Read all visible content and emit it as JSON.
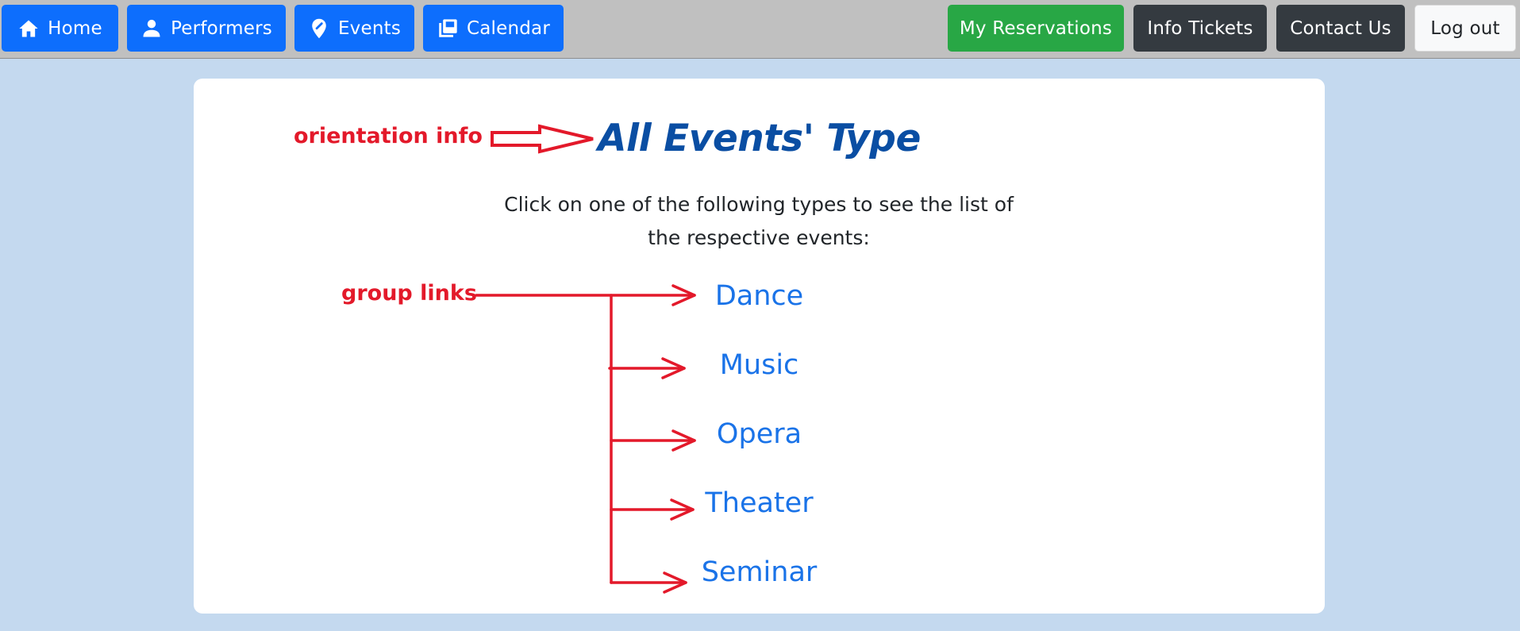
{
  "nav": {
    "left": [
      {
        "id": "home",
        "label": "Home",
        "icon": "home-icon"
      },
      {
        "id": "performers",
        "label": "Performers",
        "icon": "person-icon"
      },
      {
        "id": "events",
        "label": "Events",
        "icon": "map-pin-icon"
      },
      {
        "id": "calendar",
        "label": "Calendar",
        "icon": "stacked-pages-icon"
      }
    ],
    "right": [
      {
        "id": "reservations",
        "label": "My Reservations"
      },
      {
        "id": "info",
        "label": "Info Tickets"
      },
      {
        "id": "contact",
        "label": "Contact Us"
      },
      {
        "id": "logout",
        "label": "Log out"
      }
    ]
  },
  "main": {
    "title": "All Events' Type",
    "intro_line1": "Click on one of the following types to see the list of",
    "intro_line2": "the respective events:",
    "types": [
      "Dance",
      "Music",
      "Opera",
      "Theater",
      "Seminar"
    ]
  },
  "annotations": {
    "orientation_label": "orientation info",
    "group_label": "group links"
  },
  "colors": {
    "primary": "#0d6efd",
    "success": "#28a745",
    "dark": "#343a40",
    "light": "#f8f9fa",
    "title": "#0a4ea3",
    "link": "#1a73e8",
    "annotation": "#e3192a",
    "page_bg": "#c4d9ef",
    "navbar_bg": "#c0c0c0"
  }
}
